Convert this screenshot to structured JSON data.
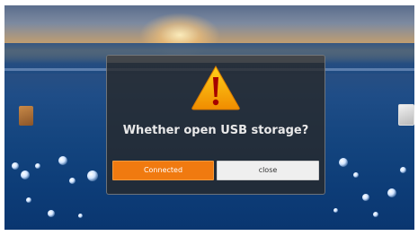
{
  "dialog": {
    "title": "Whether open USB storage?",
    "buttons": {
      "connected_label": "Connected",
      "close_label": "close"
    },
    "icon": "warning-triangle-icon"
  },
  "colors": {
    "accent": "#f07a10",
    "secondary_button": "#efefef",
    "dialog_bg": "#282828"
  }
}
